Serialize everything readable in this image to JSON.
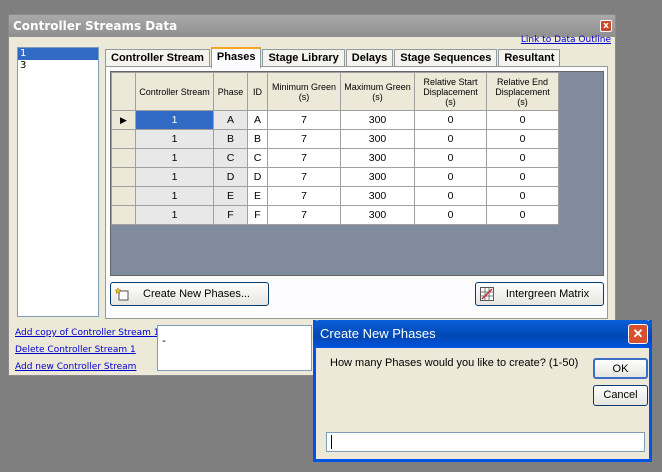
{
  "main_window": {
    "title": "Controller Streams Data",
    "close_glyph": "x",
    "outline_link": "Link to Data Outline"
  },
  "stream_list": [
    "1",
    "3"
  ],
  "tabs": [
    {
      "label": "Controller Stream"
    },
    {
      "label": "Phases"
    },
    {
      "label": "Stage Library"
    },
    {
      "label": "Delays"
    },
    {
      "label": "Stage Sequences"
    },
    {
      "label": "Resultant"
    }
  ],
  "grid": {
    "current_row_marker": "▶",
    "columns": [
      "Controller Stream",
      "Phase",
      "ID",
      "Minimum Green (s)",
      "Maximum Green (s)",
      "Relative Start Displacement (s)",
      "Relative End Displacement (s)"
    ],
    "rows": [
      [
        "1",
        "A",
        "A",
        "7",
        "300",
        "0",
        "0"
      ],
      [
        "1",
        "B",
        "B",
        "7",
        "300",
        "0",
        "0"
      ],
      [
        "1",
        "C",
        "C",
        "7",
        "300",
        "0",
        "0"
      ],
      [
        "1",
        "D",
        "D",
        "7",
        "300",
        "0",
        "0"
      ],
      [
        "1",
        "E",
        "E",
        "7",
        "300",
        "0",
        "0"
      ],
      [
        "1",
        "F",
        "F",
        "7",
        "300",
        "0",
        "0"
      ]
    ]
  },
  "buttons": {
    "create_new_phases": "Create New Phases...",
    "intergreen_matrix": "Intergreen Matrix"
  },
  "side_links": [
    "Add copy of Controller Stream 1",
    "Delete Controller Stream 1",
    "Add new Controller Stream"
  ],
  "description": "-",
  "dialog": {
    "title": "Create New Phases",
    "close_glyph": "✕",
    "prompt": "How many Phases would you like to create? (1-50)",
    "ok_label": "OK",
    "cancel_label": "Cancel",
    "input_value": ""
  },
  "colors": {
    "accent": "#316ac5",
    "dialog_title": "#0054e3",
    "link": "#0000cc"
  }
}
